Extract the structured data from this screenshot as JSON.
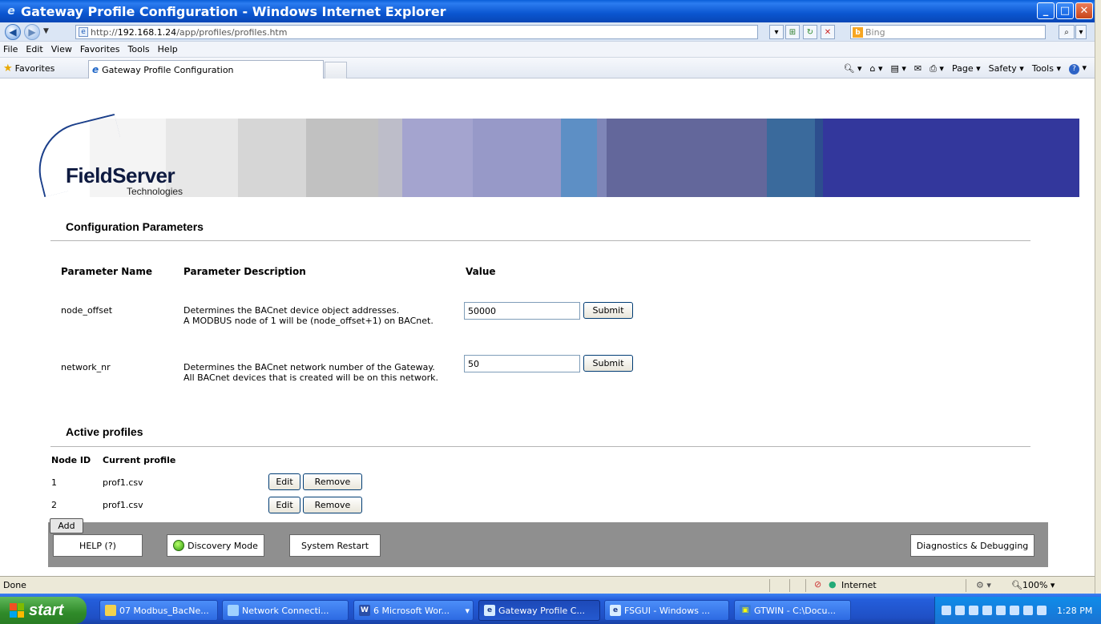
{
  "window": {
    "title": "Gateway Profile Configuration - Windows Internet Explorer",
    "controls": [
      "minimize-icon",
      "maximize-icon",
      "close-icon"
    ]
  },
  "address": {
    "url_prefix": "http://",
    "url_host": "192.168.1.24",
    "url_path": "/app/profiles/profiles.htm",
    "search_placeholder": "Bing"
  },
  "menu": [
    "File",
    "Edit",
    "View",
    "Favorites",
    "Tools",
    "Help"
  ],
  "favorites": {
    "label": "Favorites",
    "tab_title": "Gateway Profile Configuration"
  },
  "command_bar": {
    "page": "Page ▾",
    "safety": "Safety ▾",
    "tools": "Tools ▾",
    "help": "▾"
  },
  "logo": {
    "name": "FieldServer",
    "sub": "Technologies"
  },
  "config": {
    "heading": "Configuration Parameters",
    "col_name": "Parameter Name",
    "col_desc": "Parameter Description",
    "col_value": "Value",
    "params": [
      {
        "name": "node_offset",
        "desc1": "Determines the BACnet device object addresses.",
        "desc2": "A MODBUS node of 1 will be (node_offset+1) on BACnet.",
        "value": "50000",
        "button": "Submit"
      },
      {
        "name": "network_nr",
        "desc1": "Determines the BACnet network number of the Gateway.",
        "desc2": "All BACnet devices that is created will be on this network.",
        "value": "50",
        "button": "Submit"
      }
    ]
  },
  "profiles": {
    "heading": "Active profiles",
    "col_node": "Node ID",
    "col_profile": "Current profile",
    "rows": [
      {
        "node": "1",
        "profile": "prof1.csv",
        "edit": "Edit",
        "remove": "Remove"
      },
      {
        "node": "2",
        "profile": "prof1.csv",
        "edit": "Edit",
        "remove": "Remove"
      }
    ],
    "add": "Add"
  },
  "footer": {
    "help": "HELP (?)",
    "discovery": "Discovery Mode",
    "restart": "System Restart",
    "diagnostics": "Diagnostics & Debugging"
  },
  "status": {
    "text": "Done",
    "zone": "Internet",
    "zoom": "100%"
  },
  "taskbar": {
    "start": "start",
    "tasks": [
      "07 Modbus_BacNe...",
      "Network Connecti...",
      "6 Microsoft Wor...",
      "Gateway Profile C...",
      "FSGUI - Windows ...",
      "GTWIN - C:\\Docu..."
    ],
    "clock": "1:28 PM"
  }
}
